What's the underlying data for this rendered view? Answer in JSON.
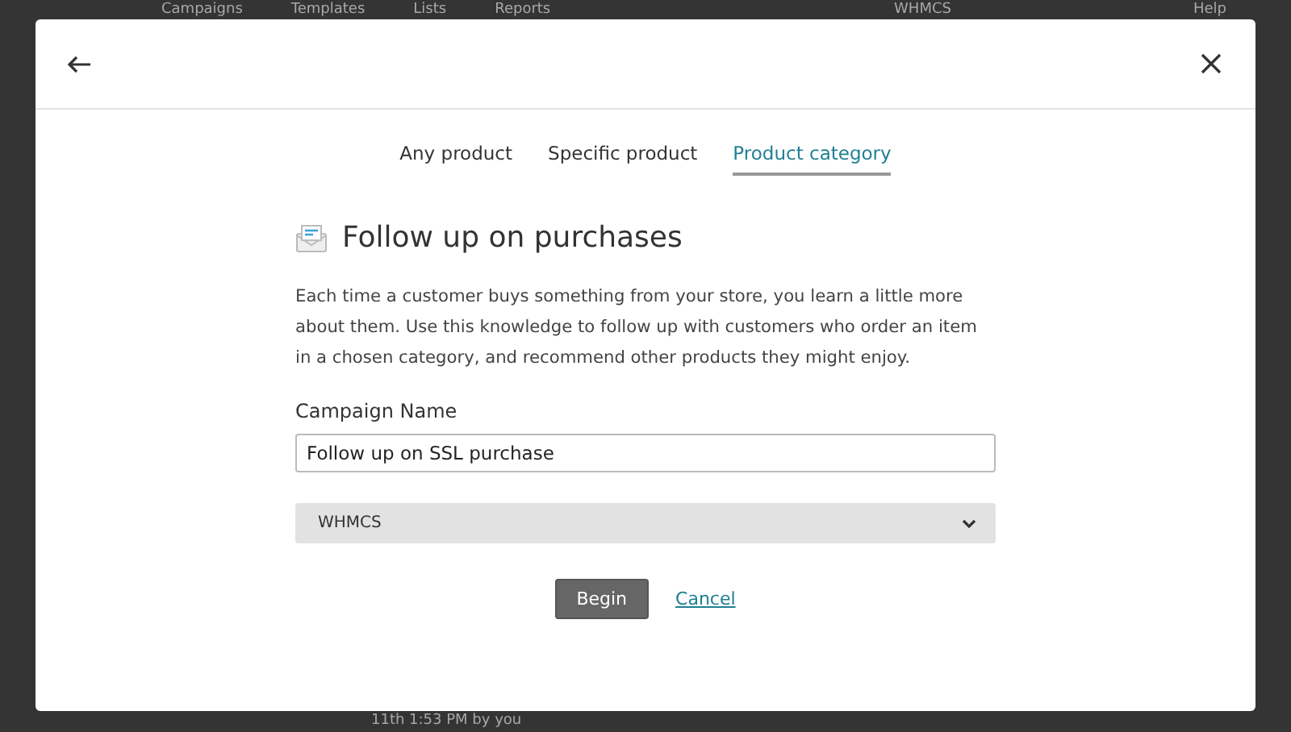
{
  "background": {
    "nav": [
      "Campaigns",
      "Templates",
      "Lists",
      "Reports"
    ],
    "account": "WHMCS",
    "help": "Help",
    "footer_text": "11th 1:53 PM by you"
  },
  "dialog": {
    "tabs": [
      {
        "label": "Any product",
        "selected": false
      },
      {
        "label": "Specific product",
        "selected": false
      },
      {
        "label": "Product category",
        "selected": true
      }
    ],
    "title": "Follow up on purchases",
    "description": "Each time a customer buys something from your store, you learn a little more about them. Use this knowledge to follow up with customers who order an item in a chosen category, and recommend other products they might enjoy.",
    "campaign_name": {
      "label": "Campaign Name",
      "value": "Follow up on SSL purchase"
    },
    "store_select": {
      "value": "WHMCS"
    },
    "buttons": {
      "primary": "Begin",
      "secondary": "Cancel"
    }
  }
}
